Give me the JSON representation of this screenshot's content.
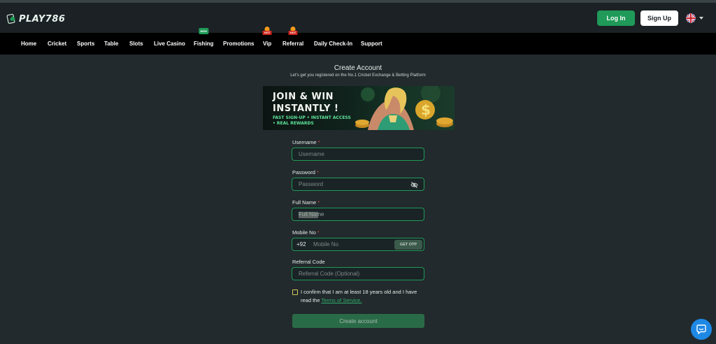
{
  "brand": {
    "logo_text": "PLAY786",
    "logo_icon": "spade-card-icon"
  },
  "header": {
    "login_label": "Log In",
    "signup_label": "Sign Up",
    "language_icon": "uk-flag-icon"
  },
  "nav": {
    "items": [
      {
        "label": "Home"
      },
      {
        "label": "Cricket"
      },
      {
        "label": "Sports"
      },
      {
        "label": "Table"
      },
      {
        "label": "Slots"
      },
      {
        "label": "Live Casino"
      },
      {
        "label": "Fishing",
        "badge": "NEW"
      },
      {
        "label": "Promotions"
      },
      {
        "label": "Vip",
        "badge": "HOT"
      },
      {
        "label": "Referral",
        "badge": "HOT"
      },
      {
        "label": "Daily Check-In"
      },
      {
        "label": "Support"
      }
    ]
  },
  "page": {
    "title": "Create Account",
    "subtitle": "Let's get you registered on the No.1 Cricket Exchange & Betting Platform"
  },
  "banner": {
    "line1": "JOIN & WIN",
    "line2": "INSTANTLY !",
    "line3": "FAST SIGN-UP • INSTANT ACCESS",
    "line4": "• REAL REWARDS"
  },
  "form": {
    "username": {
      "label": "Username",
      "required": "*",
      "placeholder": "Username",
      "value": ""
    },
    "password": {
      "label": "Password",
      "required": "*",
      "placeholder": "Password",
      "value": ""
    },
    "full_name": {
      "label": "Full Name",
      "required": "*",
      "placeholder": "Full Name",
      "value": ""
    },
    "mobile": {
      "label": "Mobile No",
      "required": "*",
      "prefix": "+92",
      "placeholder": "Mobile No",
      "value": "",
      "otp_label": "GET OTP"
    },
    "referral": {
      "label": "Referral Code",
      "placeholder": "Referral Code (Optional)",
      "value": ""
    },
    "consent_text": "I confirm that I am at least 18 years old and I have read the ",
    "tos_label": "Terms of Service.",
    "submit_label": "Create account"
  },
  "colors": {
    "accent": "#1f9a58",
    "nav_bg": "#000000",
    "header_bg": "#1b2124",
    "page_bg": "#222a2d",
    "required": "#e0463a",
    "chat": "#1e88e5"
  }
}
